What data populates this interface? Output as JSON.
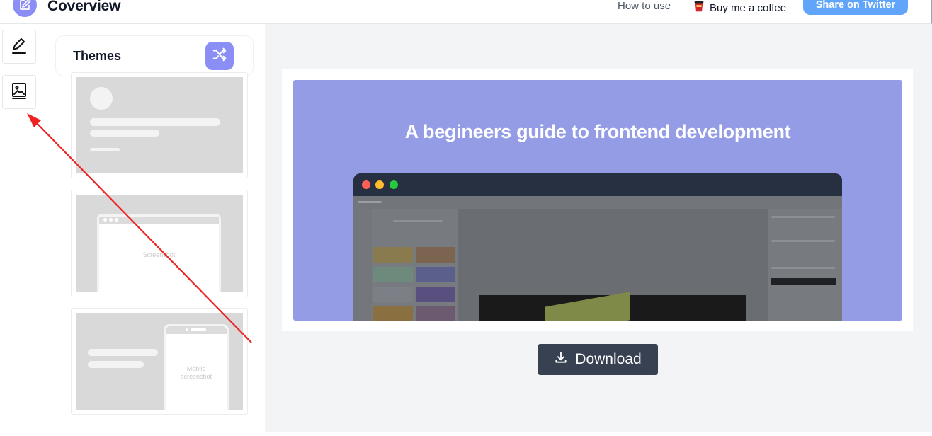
{
  "header": {
    "app_title": "Coverview",
    "how_to_use": "How to use",
    "buy_coffee": "Buy me a coffee",
    "share_twitter": "Share on Twitter"
  },
  "themes": {
    "title": "Themes",
    "cards": [
      {
        "kind": "basic"
      },
      {
        "kind": "desktop-screenshot",
        "label": "Screenshot"
      },
      {
        "kind": "mobile-screenshot",
        "label": "Mobile screenshot"
      }
    ]
  },
  "preview": {
    "cover_title": "A begineers guide to frontend development",
    "background_color": "#949ce6",
    "window_dots": [
      "#ff5f57",
      "#febc2e",
      "#28c840"
    ]
  },
  "download": {
    "label": "Download"
  },
  "colors": {
    "accent": "#8b8ff5",
    "share_button": "#60a5fa",
    "download_button": "#374151",
    "annotation_arrow": "#ee2222"
  },
  "icons": [
    "edit-icon",
    "pencil-icon",
    "image-icon",
    "shuffle-icon",
    "coffee-cup-icon",
    "download-icon",
    "arrow-annotation"
  ]
}
